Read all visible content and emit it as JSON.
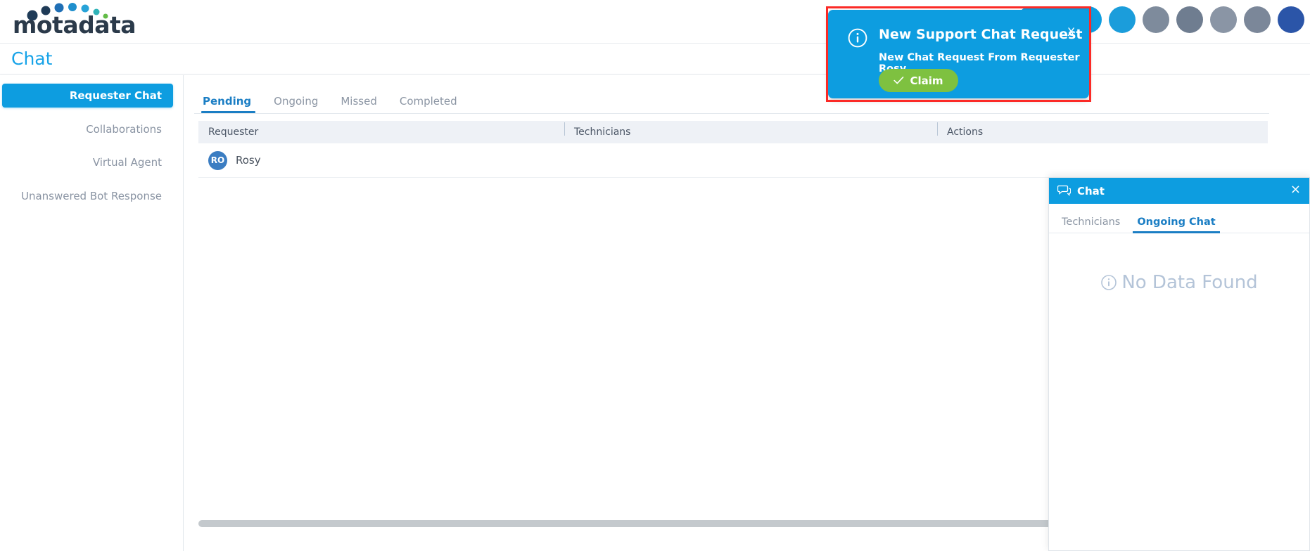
{
  "brand": {
    "name": "motadata"
  },
  "header": {
    "page_title": "Chat",
    "icons": [
      {
        "name": "new-request-pill",
        "label": "",
        "color": "#0d9de0"
      },
      {
        "name": "search-icon",
        "label": "",
        "color": "#1b9ddb"
      },
      {
        "name": "notification-bell-icon",
        "label": "",
        "color": "#7e8b9c"
      },
      {
        "name": "help-icon",
        "label": "",
        "color": "#6f7d90"
      },
      {
        "name": "apps-icon",
        "label": "",
        "color": "#8a95a5"
      },
      {
        "name": "settings-icon",
        "label": "",
        "color": "#7b8799"
      },
      {
        "name": "user-avatar",
        "label": "",
        "color": "#2b55a8"
      }
    ]
  },
  "sidebar": {
    "items": [
      {
        "label": "Requester Chat",
        "active": true
      },
      {
        "label": "Collaborations",
        "active": false
      },
      {
        "label": "Virtual Agent",
        "active": false
      },
      {
        "label": "Unanswered Bot Response",
        "active": false
      }
    ]
  },
  "main": {
    "tabs": [
      {
        "label": "Pending",
        "active": true
      },
      {
        "label": "Ongoing",
        "active": false
      },
      {
        "label": "Missed",
        "active": false
      },
      {
        "label": "Completed",
        "active": false
      }
    ],
    "table": {
      "columns": [
        "Requester",
        "Technicians",
        "Actions"
      ],
      "rows": [
        {
          "requester_initials": "RO",
          "requester": "Rosy",
          "technicians": "",
          "actions": ""
        }
      ]
    }
  },
  "chat_panel": {
    "title": "Chat",
    "close_label": "×",
    "tabs": [
      {
        "label": "Technicians",
        "active": false
      },
      {
        "label": "Ongoing Chat",
        "active": true
      }
    ],
    "empty_state": "No Data Found"
  },
  "toast": {
    "title": "New Support Chat Request",
    "message": "New Chat Request From Requester Rosy",
    "claim_label": "Claim",
    "close_label": "X",
    "background": "#0d9de0",
    "claim_color": "#7ec140",
    "highlight_color": "#fb2a26"
  }
}
